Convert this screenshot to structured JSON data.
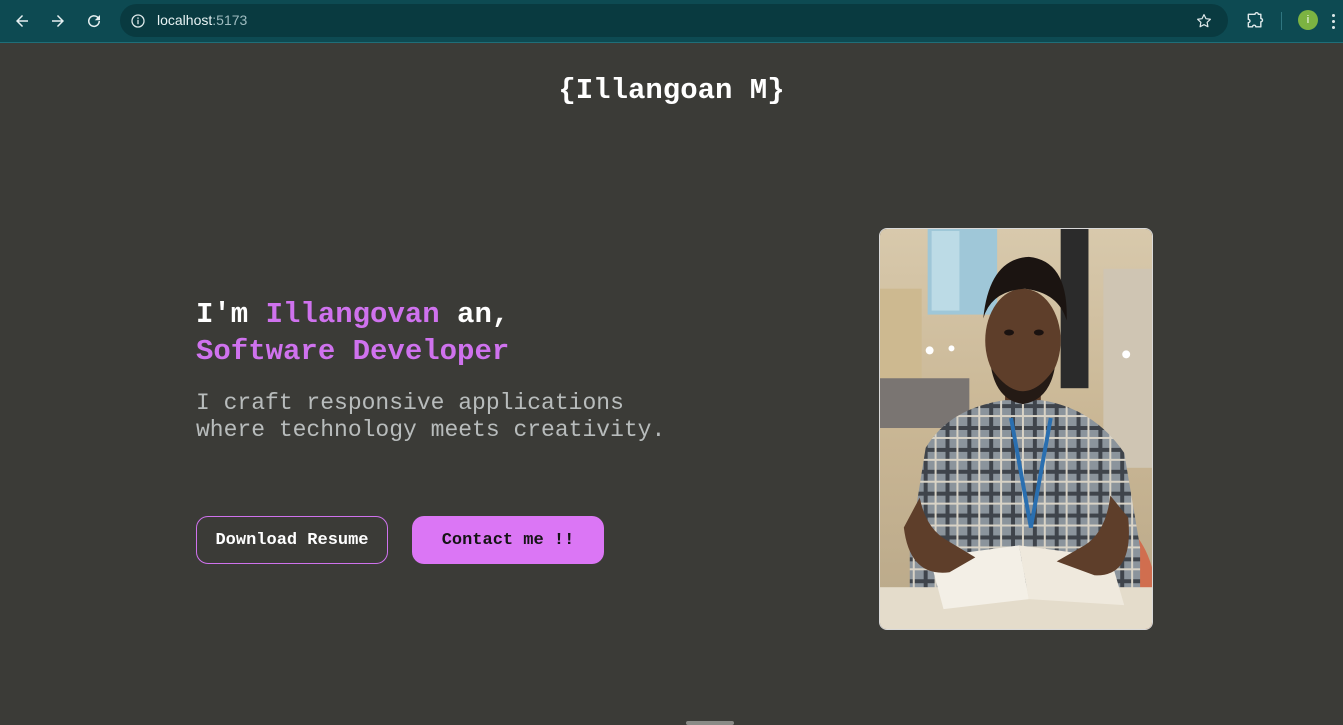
{
  "browser": {
    "url_host": "localhost",
    "url_port": ":5173",
    "profile_initial": "i",
    "icons": {
      "back": "back-arrow-icon",
      "forward": "forward-arrow-icon",
      "reload": "reload-icon",
      "site_info": "info-icon",
      "bookmark": "star-icon",
      "extensions": "puzzle-icon",
      "menu": "kebab-menu-icon"
    }
  },
  "header": {
    "brand": "{Illangoan M}"
  },
  "hero": {
    "intro_prefix": "I'm ",
    "intro_name": "Illangovan",
    "intro_suffix": " an,",
    "role": "Software Developer",
    "tagline": "I craft responsive applications where technology meets creativity.",
    "download_button": "Download Resume",
    "contact_button": "Contact me !!"
  },
  "colors": {
    "background": "#3b3b37",
    "accent": "#cf72ee",
    "button_fill": "#db76f5",
    "chrome": "#0d4a52"
  }
}
